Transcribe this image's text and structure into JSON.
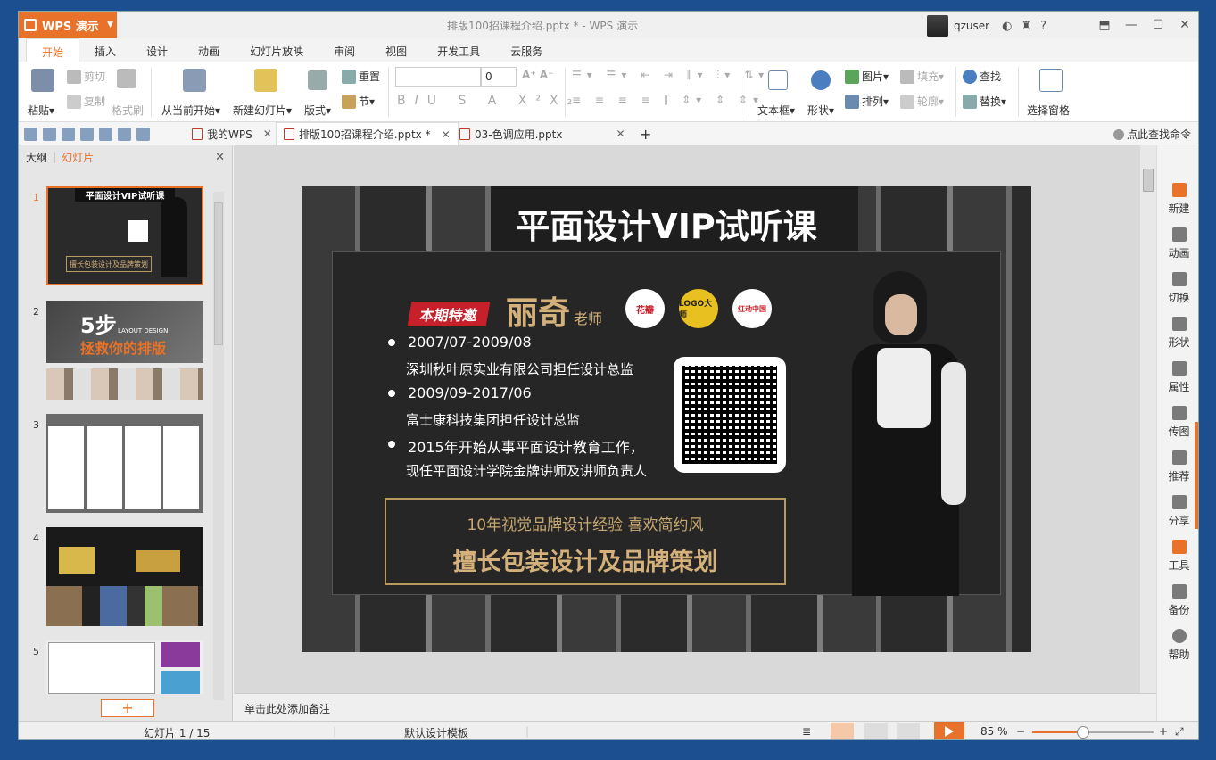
{
  "app": {
    "name": "WPS 演示",
    "title": "排版100招课程介绍.pptx * - WPS 演示",
    "user": "qzuser"
  },
  "ribbon_tabs": [
    "开始",
    "插入",
    "设计",
    "动画",
    "幻灯片放映",
    "审阅",
    "视图",
    "开发工具",
    "云服务"
  ],
  "ribbon": {
    "paste": "粘贴",
    "cut": "剪切",
    "copy": "复制",
    "format_painter": "格式刷",
    "from_current": "从当前开始",
    "new_slide": "新建幻灯片",
    "layout": "版式",
    "reset": "重置",
    "section": "节",
    "font_size": "0",
    "textbox": "文本框",
    "shape": "形状",
    "picture": "图片",
    "fill": "填充",
    "arrange": "排列",
    "outline": "轮廓",
    "find": "查找",
    "replace": "替换",
    "selection_pane": "选择窗格"
  },
  "doc_tabs": [
    {
      "label": "我的WPS"
    },
    {
      "label": "排版100招课程介绍.pptx *"
    },
    {
      "label": "03-色调应用.pptx"
    }
  ],
  "search_command": "点此查找命令",
  "left_panel": {
    "tab_outline": "大纲",
    "tab_slides": "幻灯片",
    "thumbnails": [
      {
        "num": "1",
        "caption": "平面设计VIP试听课",
        "sub": "擅长包装设计及品牌策划"
      },
      {
        "num": "2",
        "caption": "5步",
        "sub": "拯救你的排版",
        "tag": "LAYOUT DESIGN"
      },
      {
        "num": "3"
      },
      {
        "num": "4"
      },
      {
        "num": "5"
      }
    ]
  },
  "slide": {
    "title": "平面设计VIP试听课",
    "badge": "本期特邀",
    "teacher": "丽奇",
    "teacher_suffix": "老师",
    "logos": [
      "花瓣",
      "LOGO大师",
      "红动中国"
    ],
    "items": [
      {
        "period": "2007/07-2009/08",
        "desc": "深圳秋叶原实业有限公司担任设计总监"
      },
      {
        "period": "2009/09-2017/06",
        "desc": "富士康科技集团担任设计总监"
      },
      {
        "period": "2015年开始从事平面设计教育工作，",
        "desc": "现任平面设计学院金牌讲师及讲师负责人"
      }
    ],
    "highlight1": "10年视觉品牌设计经验 喜欢简约风",
    "highlight2": "擅长包装设计及品牌策划"
  },
  "notes_placeholder": "单击此处添加备注",
  "right_bar": [
    "新建",
    "动画",
    "切换",
    "形状",
    "属性",
    "传图",
    "推荐",
    "分享",
    "工具",
    "备份",
    "帮助"
  ],
  "status": {
    "slide_indicator": "幻灯片 1 / 15",
    "template": "默认设计模板",
    "zoom": "85 %",
    "zoom_fraction": 0.42
  },
  "colors": {
    "accent": "#e8722a",
    "gold": "#d4b07a",
    "badge_red": "#c8202a"
  }
}
